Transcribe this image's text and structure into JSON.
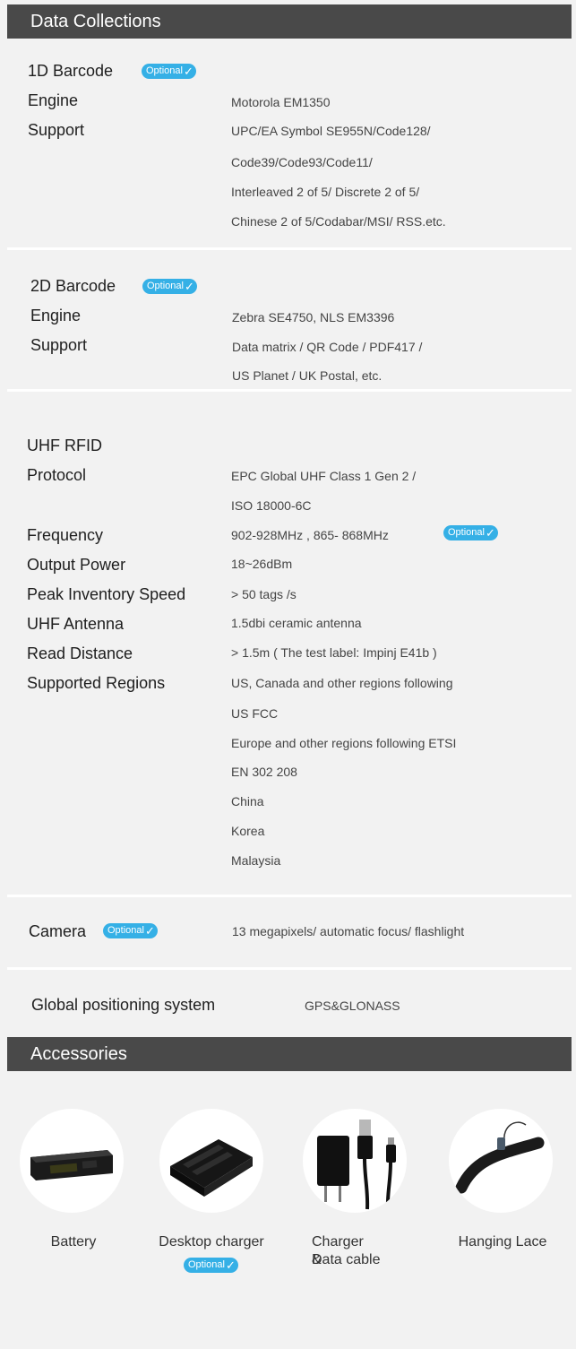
{
  "badge": {
    "label": "Optional",
    "check": "✓"
  },
  "data_collections": {
    "title": "Data Collections",
    "barcode_1d": {
      "heading": "1D Barcode",
      "engine_label": "Engine",
      "engine_value": "Motorola EM1350",
      "support_label": "Support",
      "support_lines": [
        "UPC/EA Symbol SE955N/Code128/",
        "Code39/Code93/Code11/",
        "Interleaved 2 of 5/ Discrete 2 of 5/",
        "Chinese 2 of 5/Codabar/MSI/ RSS.etc."
      ]
    },
    "barcode_2d": {
      "heading": "2D Barcode",
      "engine_label": "Engine",
      "engine_value": "Zebra SE4750, NLS EM3396",
      "support_label": "Support",
      "support_lines": [
        "Data matrix / QR Code / PDF417 /",
        "US Planet / UK Postal, etc."
      ]
    },
    "uhf_rfid": {
      "heading": "UHF RFID",
      "protocol_label": "Protocol",
      "protocol_lines": [
        "EPC Global UHF Class 1 Gen 2 /",
        "ISO 18000-6C"
      ],
      "frequency_label": "Frequency",
      "frequency_value": "902-928MHz , 865- 868MHz",
      "output_power_label": "Output Power",
      "output_power_value": "18~26dBm",
      "inventory_speed_label": "Peak Inventory Speed",
      "inventory_speed_value": "> 50 tags /s",
      "antenna_label": "UHF Antenna",
      "antenna_value": "1.5dbi ceramic antenna",
      "read_distance_label": "Read Distance",
      "read_distance_value": "> 1.5m ( The test label: Impinj E41b )",
      "regions_label": "Supported Regions",
      "regions_lines": [
        "US, Canada and other regions following",
        "US FCC",
        "Europe and other regions following ETSI",
        "EN 302 208",
        "China",
        "Korea",
        "Malaysia"
      ]
    },
    "camera": {
      "label": "Camera",
      "value": "13 megapixels/ automatic focus/ flashlight"
    },
    "gps": {
      "label": "Global positioning system",
      "value": "GPS&GLONASS"
    }
  },
  "accessories": {
    "title": "Accessories",
    "items": [
      {
        "icon": "battery-icon",
        "caption": "Battery"
      },
      {
        "icon": "desktop-charger-icon",
        "caption": "Desktop charger"
      },
      {
        "icon": "charger-cable-icon",
        "caption_line1": "Charger &",
        "caption_line2": "Data cable"
      },
      {
        "icon": "lanyard-icon",
        "caption": "Hanging Lace"
      }
    ]
  },
  "colors": {
    "header_bg": "#494949",
    "page_bg": "#f2f2f2",
    "badge_bg": "#35b0e6"
  }
}
